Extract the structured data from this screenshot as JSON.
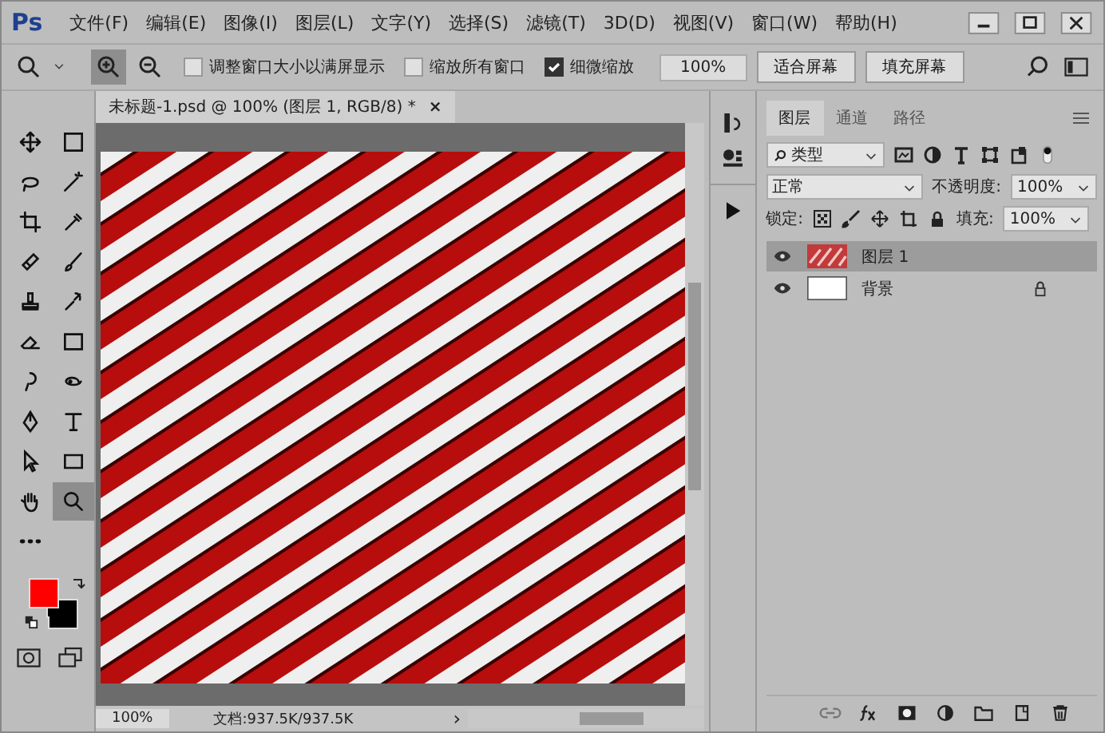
{
  "app": {
    "logo": "Ps"
  },
  "menu": [
    "文件(F)",
    "编辑(E)",
    "图像(I)",
    "图层(L)",
    "文字(Y)",
    "选择(S)",
    "滤镜(T)",
    "3D(D)",
    "视图(V)",
    "窗口(W)",
    "帮助(H)"
  ],
  "options": {
    "checks": [
      {
        "label": "调整窗口大小以满屏显示",
        "checked": false
      },
      {
        "label": "缩放所有窗口",
        "checked": false
      },
      {
        "label": "细微缩放",
        "checked": true
      }
    ],
    "zoom_value": "100%",
    "buttons": [
      "适合屏幕",
      "填充屏幕"
    ]
  },
  "document": {
    "tab_title": "未标题-1.psd @ 100% (图层 1, RGB/8) *",
    "tab_close": "×",
    "zoom": "100%",
    "doc_info": "文档:937.5K/937.5K",
    "status_arrow": "›"
  },
  "tools": [
    {
      "kind": "move",
      "selected": false
    },
    {
      "kind": "marquee",
      "selected": false
    },
    {
      "kind": "lasso",
      "selected": false
    },
    {
      "kind": "wand",
      "selected": false
    },
    {
      "kind": "crop",
      "selected": false
    },
    {
      "kind": "eyedropper",
      "selected": false
    },
    {
      "kind": "healing",
      "selected": false
    },
    {
      "kind": "brush",
      "selected": false
    },
    {
      "kind": "stamp",
      "selected": false
    },
    {
      "kind": "history",
      "selected": false
    },
    {
      "kind": "eraser",
      "selected": false
    },
    {
      "kind": "gradient",
      "selected": false
    },
    {
      "kind": "dodge",
      "selected": false
    },
    {
      "kind": "smudge",
      "selected": false
    },
    {
      "kind": "pen",
      "selected": false
    },
    {
      "kind": "type",
      "selected": false
    },
    {
      "kind": "select",
      "selected": false
    },
    {
      "kind": "rect",
      "selected": false
    },
    {
      "kind": "hand",
      "selected": false
    },
    {
      "kind": "zoom",
      "selected": true
    },
    {
      "kind": "more",
      "selected": false
    }
  ],
  "color_swatches": [
    {
      "kind": "foreground",
      "color": "#ff0000"
    },
    {
      "kind": "background",
      "color": "#000000"
    }
  ],
  "layers_panel": {
    "tabs": [
      {
        "label": "图层",
        "selected": true
      },
      {
        "label": "通道",
        "selected": false
      },
      {
        "label": "路径",
        "selected": false
      }
    ],
    "filter": "类型",
    "blend_mode": "正常",
    "opacity_label": "不透明度:",
    "opacity": "100%",
    "lock_label": "锁定:",
    "fill_label": "填充:",
    "fill": "100%",
    "layers": [
      {
        "name": "图层 1",
        "kind": "texture",
        "selected": true,
        "visible": true,
        "locked": false
      },
      {
        "name": "背景",
        "kind": "white",
        "selected": false,
        "visible": true,
        "locked": true
      }
    ]
  }
}
